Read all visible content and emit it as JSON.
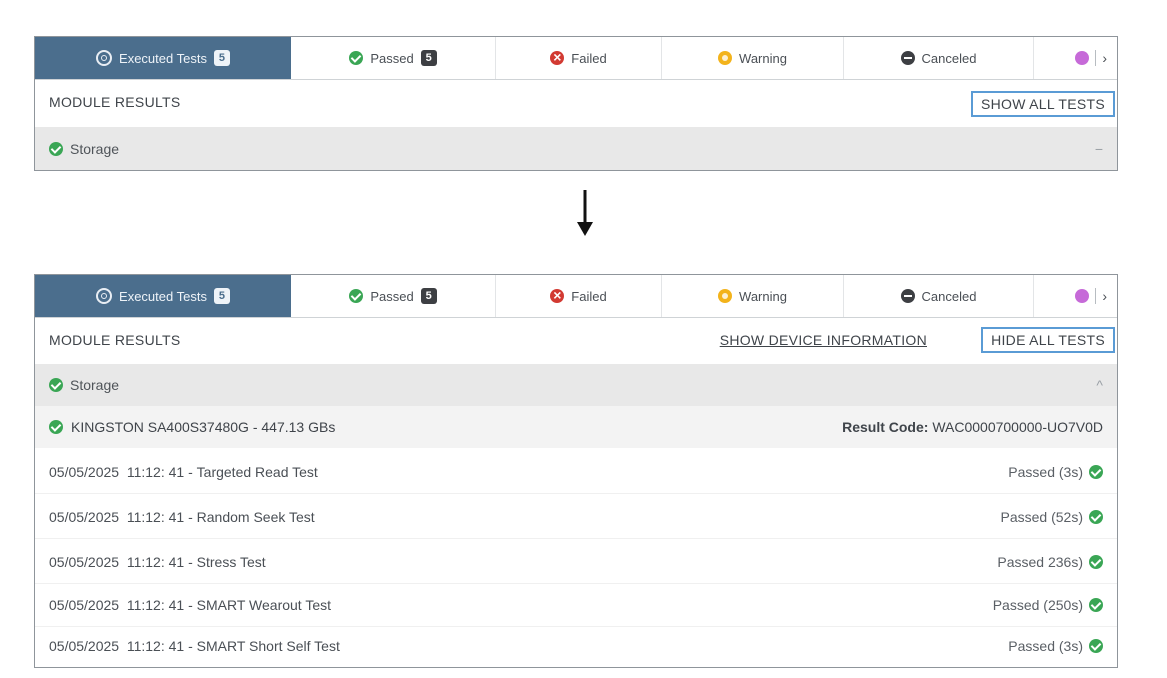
{
  "tabs": [
    {
      "label": "Executed Tests",
      "count": "5",
      "icon": "executed-icon"
    },
    {
      "label": "Passed",
      "count": "5",
      "icon": "check-circle-icon"
    },
    {
      "label": "Failed",
      "icon": "x-circle-icon"
    },
    {
      "label": "Warning",
      "icon": "warning-circle-icon"
    },
    {
      "label": "Canceled",
      "icon": "minus-circle-icon"
    }
  ],
  "before": {
    "module_results": "MODULE RESULTS",
    "show_all_tests": "SHOW ALL TESTS",
    "module_name": "Storage",
    "toggle": "−"
  },
  "after": {
    "module_results": "MODULE RESULTS",
    "show_device_information": "SHOW DEVICE INFORMATION",
    "hide_all_tests": "HIDE ALL TESTS",
    "module_name": "Storage",
    "toggle": "^",
    "device_name": "KINGSTON SA400S37480G - 447.13 GBs",
    "result_code_label": "Result Code:",
    "result_code_value": "WAC0000700000-UO7V0D",
    "tests": [
      {
        "timestamp": "05/05/2025  11:12: 41",
        "name": "Targeted Read Test",
        "result": "Passed (3s)"
      },
      {
        "timestamp": "05/05/2025  11:12: 41",
        "name": "Random Seek Test",
        "result": "Passed (52s)"
      },
      {
        "timestamp": "05/05/2025  11:12: 41",
        "name": "Stress Test",
        "result": "Passed 236s)"
      },
      {
        "timestamp": "05/05/2025  11:12: 41",
        "name": "SMART Wearout Test",
        "result": "Passed (250s)"
      },
      {
        "timestamp": "05/05/2025  11:12: 41",
        "name": "SMART Short Self Test",
        "result": "Passed (3s)"
      }
    ]
  },
  "colors": {
    "active_tab": "#4b6e8d",
    "passed": "#3aa655",
    "failed": "#d23a32",
    "warning": "#f3b31b",
    "canceled": "#3d3f43",
    "extra": "#c66ad8",
    "button_border": "#5a9bd5"
  }
}
